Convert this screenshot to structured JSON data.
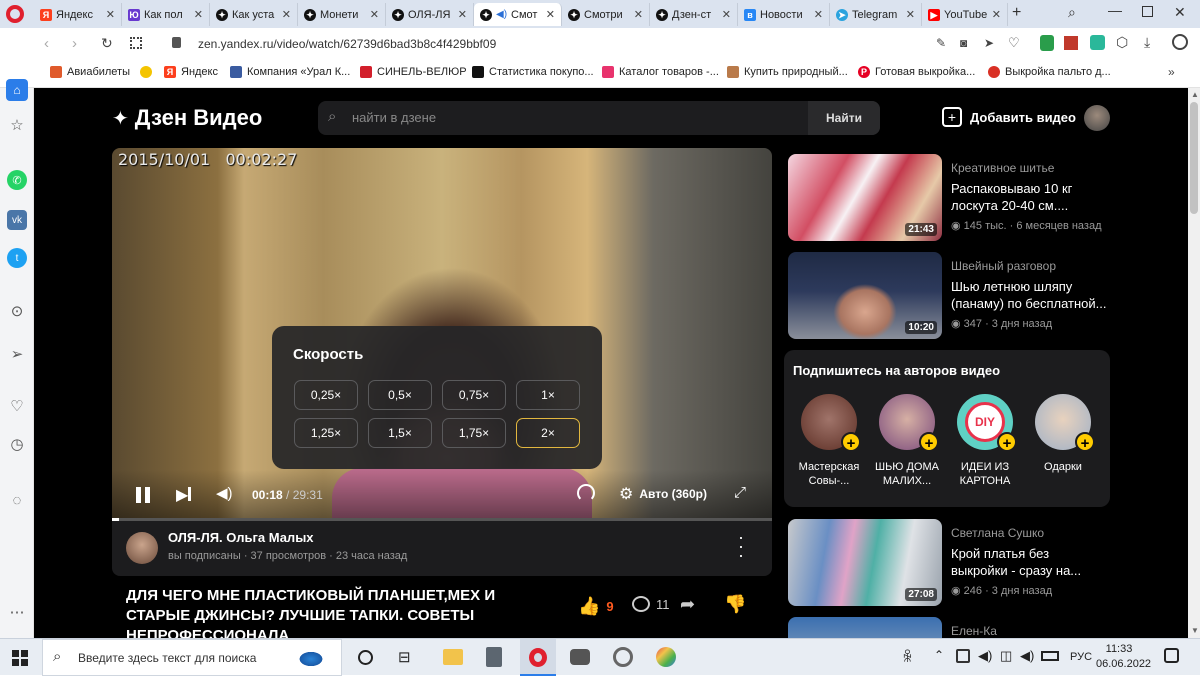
{
  "tabs": [
    {
      "label": "Яндекс",
      "icon": "yandex-icon",
      "color": "#fc3f1d"
    },
    {
      "label": "Как пол",
      "icon": "yandex-cloud-icon",
      "color": "#6839cf"
    },
    {
      "label": "Как уста",
      "icon": "zen-icon",
      "color": "#000000"
    },
    {
      "label": "Монети",
      "icon": "zen-icon",
      "color": "#000000"
    },
    {
      "label": "ОЛЯ-ЛЯ",
      "icon": "zen-icon",
      "color": "#000000"
    },
    {
      "label": "Смот",
      "icon": "zen-icon",
      "color": "#000000"
    },
    {
      "label": "Смотри",
      "icon": "zen-icon",
      "color": "#000000"
    },
    {
      "label": "Дзен-ст",
      "icon": "zen-icon",
      "color": "#000000"
    },
    {
      "label": "Новости",
      "icon": "vk-icon",
      "color": "#2787f5"
    },
    {
      "label": "Telegram",
      "icon": "telegram-icon",
      "color": "#2aa3de"
    },
    {
      "label": "YouTube",
      "icon": "youtube-icon",
      "color": "#ff0000"
    }
  ],
  "url": "zen.yandex.ru/video/watch/62739d6bad3b8c4f429bbf09",
  "bookmarks": [
    {
      "label": "Авиабилеты",
      "color": "#e05a2b"
    },
    {
      "label": "",
      "color": "#f4c400"
    },
    {
      "label": "Яндекс",
      "color": "#fc3f1d"
    },
    {
      "label": "Компания «Урал К...",
      "color": "#3a5ba0"
    },
    {
      "label": "СИНЕЛЬ-ВЕЛЮР",
      "color": "#d21f2b"
    },
    {
      "label": "Статистика покупо...",
      "color": "#111111"
    },
    {
      "label": "Каталог товаров -...",
      "color": "#e8336d"
    },
    {
      "label": "Купить природный...",
      "color": "#b97a4a"
    },
    {
      "label": "Готовая выкройка...",
      "color": "#e60023"
    },
    {
      "label": "Выкройка пальто д...",
      "color": "#d93025"
    }
  ],
  "zen": {
    "logo": "Дзен Видео",
    "search_placeholder": "найти в дзене",
    "search_button": "Найти",
    "add_video": "Добавить видео"
  },
  "video": {
    "overlay_date": "2015/10/01",
    "overlay_time": "00:02:27",
    "time_current": "00:18",
    "time_total": "/ 29:31",
    "quality": "Авто (360p)",
    "progress": 0.01,
    "speed_title": "Скорость",
    "speeds": [
      "0,25×",
      "0,5×",
      "0,75×",
      "1×",
      "1,25×",
      "1,5×",
      "1,75×",
      "2×"
    ],
    "selected_speed": "2×"
  },
  "channel": {
    "name": "ОЛЯ-ЛЯ. Ольга Малых",
    "meta": "вы подписаны · 37 просмотров · 23 часа назад"
  },
  "title": {
    "line1": "ДЛЯ ЧЕГО МНЕ ПЛАСТИКОВЫЙ ПЛАНШЕТ,МЕХ И",
    "line2": "СТАРЫЕ ДЖИНСЫ? ЛУЧШИЕ ТАПКИ. СОВЕТЫ",
    "line3": "НЕПРОФЕССИОНАЛА",
    "likes": "9",
    "comments": "11"
  },
  "recommendations": [
    {
      "channel": "Креативное шитье",
      "title1": "Распаковываю 10 кг",
      "title2": "лоскута 20-40 см....",
      "meta": "145 тыс. · 6 месяцев назад",
      "duration": "21:43"
    },
    {
      "channel": "Швейный разговор",
      "title1": "Шью летнюю шляпу",
      "title2": "(панаму) по бесплатной...",
      "meta": "347 · 3 дня назад",
      "duration": "10:20"
    },
    {
      "channel": "Светлана Сушко",
      "title1": "Крой платья без",
      "title2": "выкройки - сразу на...",
      "meta": "246 · 3 дня назад",
      "duration": "27:08"
    },
    {
      "channel": "Елен-Ка",
      "title1": "",
      "title2": "",
      "meta": "",
      "duration": ""
    }
  ],
  "subscribe": {
    "title": "Подпишитесь на авторов видео",
    "authors": [
      {
        "line1": "Мастерская",
        "line2": "Совы-..."
      },
      {
        "line1": "ШЬЮ ДОМА",
        "line2": "МАЛИХ..."
      },
      {
        "line1": "ИДЕИ ИЗ",
        "line2": "КАРТОНА"
      },
      {
        "line1": "Одарки",
        "line2": ""
      }
    ]
  },
  "taskbar": {
    "search_placeholder": "Введите здесь текст для поиска",
    "language": "РУС",
    "time": "11:33",
    "date": "06.06.2022"
  }
}
